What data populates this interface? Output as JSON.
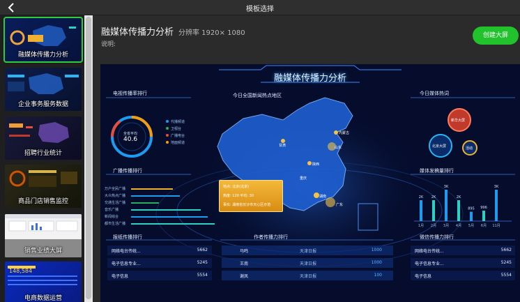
{
  "header": {
    "title": "模板选择"
  },
  "sidebar": {
    "templates": [
      {
        "label": "融媒体传播力分析",
        "active": true
      },
      {
        "label": "企业事务服务数据",
        "active": false
      },
      {
        "label": "招聘行业统计",
        "active": false
      },
      {
        "label": "商品门店销售监控",
        "active": false
      },
      {
        "label": "销售业绩大屏",
        "active": false
      },
      {
        "label": "电商数据运营",
        "active": false
      }
    ],
    "thumb_stat": "148,584"
  },
  "main": {
    "title": "融媒体传播力分析",
    "resolution": "分辨率 1920× 1080",
    "description_label": "说明:",
    "create_button": "创建大屏"
  },
  "preview": {
    "title": "融媒体传播力分析",
    "tv_rank": {
      "title": "电视传播率排行",
      "gauge_label": "全省平均",
      "gauge_value": "40.6",
      "legend": [
        "代播频道",
        "卫视台",
        "广播电台",
        "地面频道"
      ]
    },
    "map": {
      "title": "今日全国新闻热点地区",
      "popup": [
        "地点: 北京(北京)",
        "热度: 120    平均: 30",
        "事实: 湖南省长沙市天心区示范"
      ],
      "cities": [
        "内蒙古",
        "甘肃",
        "陕西",
        "山东",
        "湖南",
        "广东",
        "重庆"
      ]
    },
    "media_today": {
      "title": "今日媒体热词",
      "bubbles": [
        "新华大屏",
        "北京大屏",
        "活动"
      ]
    },
    "radio_rank": {
      "title": "广播传播排行",
      "rows": [
        "万户全民广播",
        "大众热点广播",
        "交通生活广播",
        "音乐广播",
        "新闻综合",
        "都市生活广播"
      ]
    },
    "media_rank": {
      "title": "媒体发稿量排行",
      "bars": [
        {
          "label": "1月",
          "value": 2,
          "text": "2K"
        },
        {
          "label": "2月",
          "value": 2,
          "text": "2K"
        },
        {
          "label": "3月",
          "value": 3,
          "text": "3K"
        },
        {
          "label": "4月",
          "value": 2,
          "text": "2K"
        },
        {
          "label": "5月",
          "value": 0.895,
          "text": "895"
        },
        {
          "label": "6月",
          "value": 0.996,
          "text": "996"
        },
        {
          "label": "11月",
          "value": 3,
          "text": "3K"
        }
      ]
    },
    "news_rank": {
      "title": "报纸传播排行",
      "rows": [
        {
          "name": "网络电台传统...",
          "value": "5662"
        },
        {
          "name": "电子信息专业...",
          "value": "5245"
        },
        {
          "name": "电子信息",
          "value": "5554"
        }
      ]
    },
    "author_rank": {
      "title": "作者传播力排行",
      "rows": [
        {
          "name": "马鸣",
          "org": "天津日报",
          "value": "1000"
        },
        {
          "name": "王南",
          "org": "天津日报",
          "value": "1000"
        },
        {
          "name": "谢凤",
          "org": "天津日报",
          "value": "100"
        }
      ]
    },
    "wechat_rank": {
      "title": "微信传播力排行",
      "rows": [
        {
          "name": "网络电台传统...",
          "value": "5662"
        },
        {
          "name": "电子信息专业...",
          "value": "5245"
        },
        {
          "name": "电子信息",
          "value": "5554"
        }
      ]
    }
  }
}
